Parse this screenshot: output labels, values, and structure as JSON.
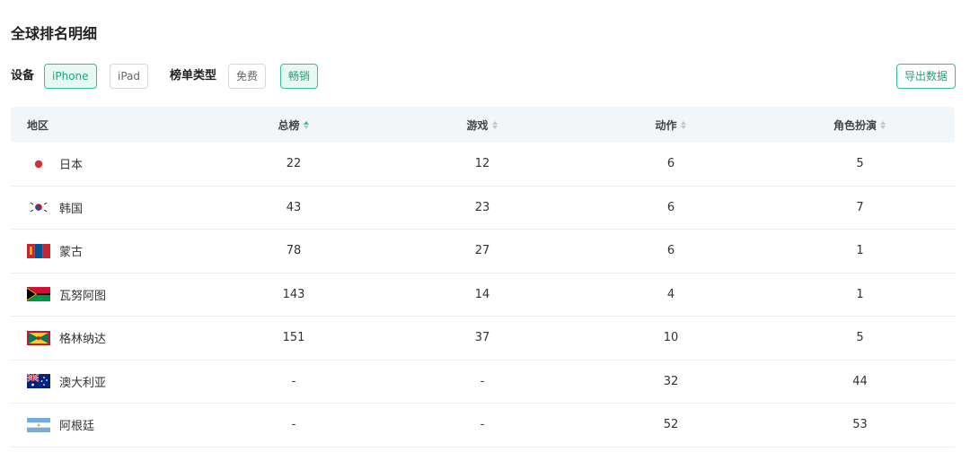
{
  "title": "全球排名明细",
  "filters": {
    "device_label": "设备",
    "device_options": [
      {
        "label": "iPhone",
        "active": true
      },
      {
        "label": "iPad",
        "active": false
      }
    ],
    "chart_type_label": "榜单类型",
    "chart_type_options": [
      {
        "label": "免费",
        "active": false
      },
      {
        "label": "畅销",
        "active": true
      }
    ],
    "export_label": "导出数据"
  },
  "table": {
    "columns": [
      {
        "label": "地区",
        "sortable": false
      },
      {
        "label": "总榜",
        "sortable": true,
        "sort": "asc"
      },
      {
        "label": "游戏",
        "sortable": true,
        "sort": "none"
      },
      {
        "label": "动作",
        "sortable": true,
        "sort": "none"
      },
      {
        "label": "角色扮演",
        "sortable": true,
        "sort": "none"
      }
    ],
    "rows": [
      {
        "flag": "jp-flag-icon",
        "region": "日本",
        "total": "22",
        "games": "12",
        "action": "6",
        "rpg": "5"
      },
      {
        "flag": "kr-flag-icon",
        "region": "韩国",
        "total": "43",
        "games": "23",
        "action": "6",
        "rpg": "7"
      },
      {
        "flag": "mn-flag-icon",
        "region": "蒙古",
        "total": "78",
        "games": "27",
        "action": "6",
        "rpg": "1"
      },
      {
        "flag": "vu-flag-icon",
        "region": "瓦努阿图",
        "total": "143",
        "games": "14",
        "action": "4",
        "rpg": "1"
      },
      {
        "flag": "gd-flag-icon",
        "region": "格林纳达",
        "total": "151",
        "games": "37",
        "action": "10",
        "rpg": "5"
      },
      {
        "flag": "au-flag-icon",
        "region": "澳大利亚",
        "total": "-",
        "games": "-",
        "action": "32",
        "rpg": "44"
      },
      {
        "flag": "ar-flag-icon",
        "region": "阿根廷",
        "total": "-",
        "games": "-",
        "action": "52",
        "rpg": "53"
      }
    ]
  },
  "colors": {
    "accent": "#2bc39a",
    "accent_text": "#17a87e",
    "header_bg": "#f3f6f9"
  }
}
